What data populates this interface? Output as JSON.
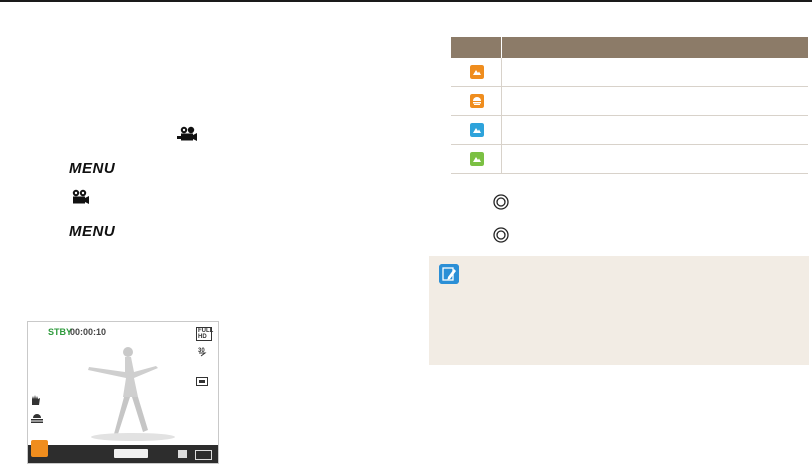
{
  "menu_steps": {
    "glyph_menu": "MENU"
  },
  "table": {
    "header": {
      "col_icon": "",
      "col_desc": ""
    },
    "rows": [
      {
        "icon": "orange-scene-icon",
        "color": "#ef8d1e",
        "desc": ""
      },
      {
        "icon": "orange-night-icon",
        "color": "#ef8d1e",
        "desc": ""
      },
      {
        "icon": "blue-scene-icon",
        "color": "#2ea3db",
        "desc": ""
      },
      {
        "icon": "green-scene-icon",
        "color": "#7bc043",
        "desc": ""
      }
    ],
    "header_color": "#8c7b68"
  },
  "shutter_steps": [
    {
      "icon": "shutter-button-icon",
      "text": ""
    },
    {
      "icon": "shutter-button-icon",
      "text": ""
    }
  ],
  "note": {
    "icon": "note-pencil-icon",
    "background": "#f2ece4",
    "text": ""
  },
  "viewfinder": {
    "status": "STBY",
    "time": "00:00:10",
    "quality_badge": "FULL HD",
    "status_color": "#2e9a3c"
  }
}
